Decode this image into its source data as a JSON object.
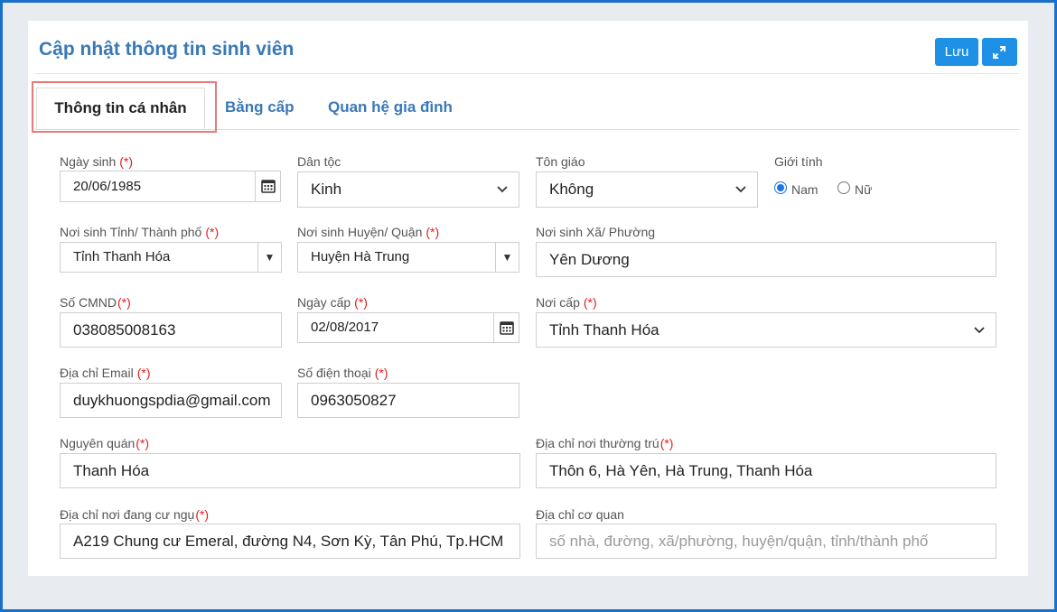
{
  "header": {
    "title": "Cập nhật thông tin sinh viên",
    "save_label": "Lưu"
  },
  "tabs": [
    {
      "label": "Thông tin cá nhân",
      "active": true
    },
    {
      "label": "Bằng cấp",
      "active": false
    },
    {
      "label": "Quan hệ gia đình",
      "active": false
    }
  ],
  "required_mark": "(*)",
  "form": {
    "birth_date": {
      "label": "Ngày sinh",
      "value": "20/06/1985"
    },
    "ethnicity": {
      "label": "Dân tộc",
      "value": "Kinh"
    },
    "religion": {
      "label": "Tôn giáo",
      "value": "Không"
    },
    "gender": {
      "label": "Giới tính",
      "options": [
        "Nam",
        "Nữ"
      ],
      "selected": "Nam"
    },
    "birth_province": {
      "label": "Nơi sinh Tỉnh/ Thành phố",
      "value": "Tỉnh Thanh Hóa"
    },
    "birth_district": {
      "label": "Nơi sinh Huyện/ Quận",
      "value": "Huyện Hà Trung"
    },
    "birth_commune": {
      "label": "Nơi sinh Xã/ Phường",
      "value": "Yên Dương"
    },
    "id_number": {
      "label": "Số CMND",
      "value": "038085008163"
    },
    "issue_date": {
      "label": "Ngày cấp",
      "value": "02/08/2017"
    },
    "issue_place": {
      "label": "Nơi cấp",
      "value": "Tỉnh Thanh Hóa"
    },
    "email": {
      "label": "Địa chỉ Email",
      "value": "duykhuongspdia@gmail.com"
    },
    "phone": {
      "label": "Số điện thoại",
      "value": "0963050827"
    },
    "hometown": {
      "label": "Nguyên quán",
      "value": "Thanh Hóa"
    },
    "permanent_address": {
      "label": "Địa chỉ nơi thường trú",
      "value": "Thôn 6, Hà Yên, Hà Trung, Thanh Hóa"
    },
    "current_address": {
      "label": "Địa chỉ nơi đang cư ngụ",
      "value": "A219 Chung cư Emeral, đường N4, Sơn Kỳ, Tân Phú, Tp.HCM"
    },
    "work_address": {
      "label": "Địa chỉ cơ quan",
      "value": "",
      "placeholder": "số nhà, đường, xã/phường, huyện/quận, tỉnh/thành phố"
    }
  },
  "colors": {
    "accent": "#1e90e6",
    "title": "#3a78b6",
    "required": "#e02020",
    "frame": "#1a6fc9",
    "tab_highlight": "#e57a78"
  }
}
